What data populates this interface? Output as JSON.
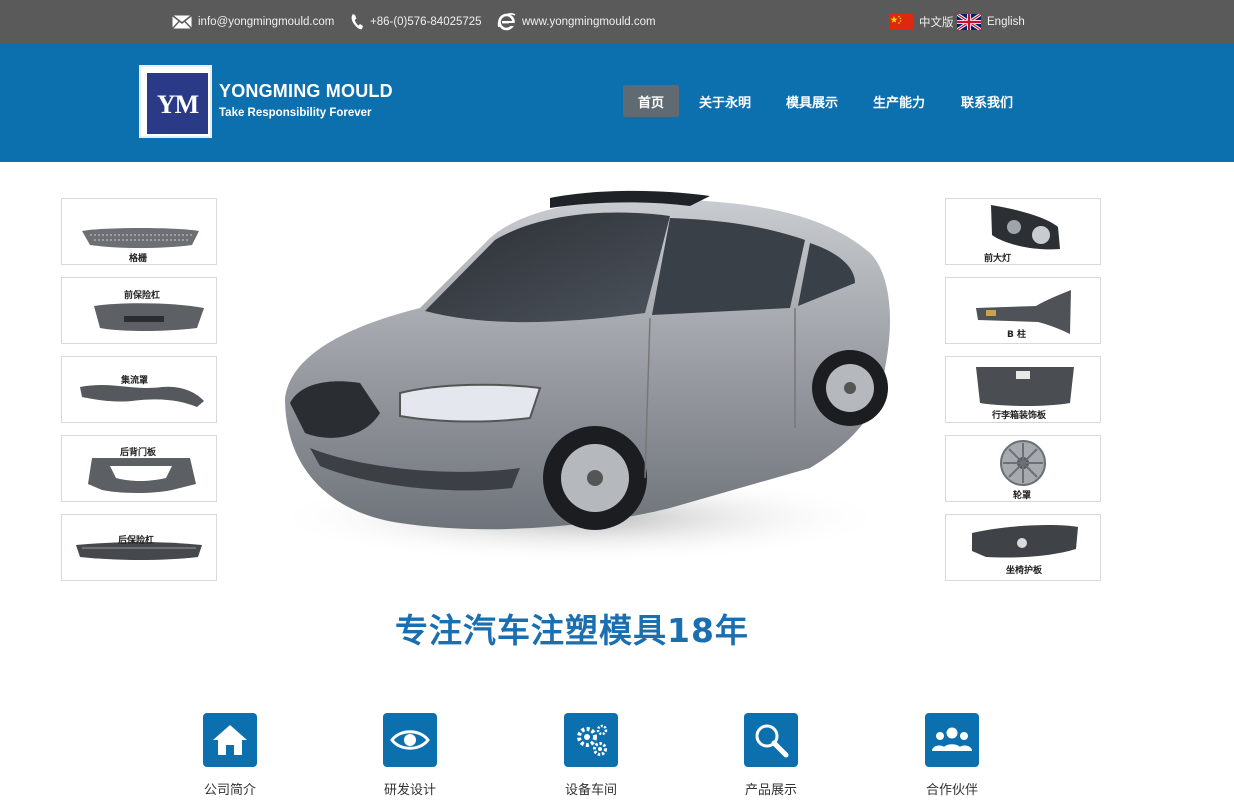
{
  "topbar": {
    "email": "info@yongmingmould.com",
    "phone": "+86-(0)576-84025725",
    "website": "www.yongmingmould.com",
    "lang_cn": "中文版",
    "lang_en": "English",
    "icons": [
      "mail-icon",
      "phone-icon",
      "ie-icon",
      "china-flag-icon",
      "uk-flag-icon"
    ]
  },
  "header": {
    "logo_text": "YM",
    "brand_name": "YONGMING MOULD",
    "tagline": "Take Responsibility Forever",
    "nav": [
      "首页",
      "关于永明",
      "模具展示",
      "生产能力",
      "联系我们"
    ],
    "active_nav": "首页"
  },
  "hero": {
    "left_parts": [
      "格栅",
      "前保险杠",
      "集流罩",
      "后背门板",
      "后保险杠"
    ],
    "right_parts": [
      "前大灯",
      "B 柱",
      "行李箱装饰板",
      "轮罩",
      "坐椅护板"
    ],
    "slogan": "专注汽车注塑模具18年"
  },
  "features": [
    {
      "label": "公司简介",
      "icon": "home-icon"
    },
    {
      "label": "研发设计",
      "icon": "eye-icon"
    },
    {
      "label": "设备车间",
      "icon": "gears-icon"
    },
    {
      "label": "产品展示",
      "icon": "magnifier-icon"
    },
    {
      "label": "合作伙伴",
      "icon": "people-icon"
    }
  ],
  "colors": {
    "topbar": "#5a5a5a",
    "header": "#0c6fae",
    "logo": "#2a3a86",
    "slogan": "#1a6fb0",
    "nav_active": "#5f6a72"
  }
}
